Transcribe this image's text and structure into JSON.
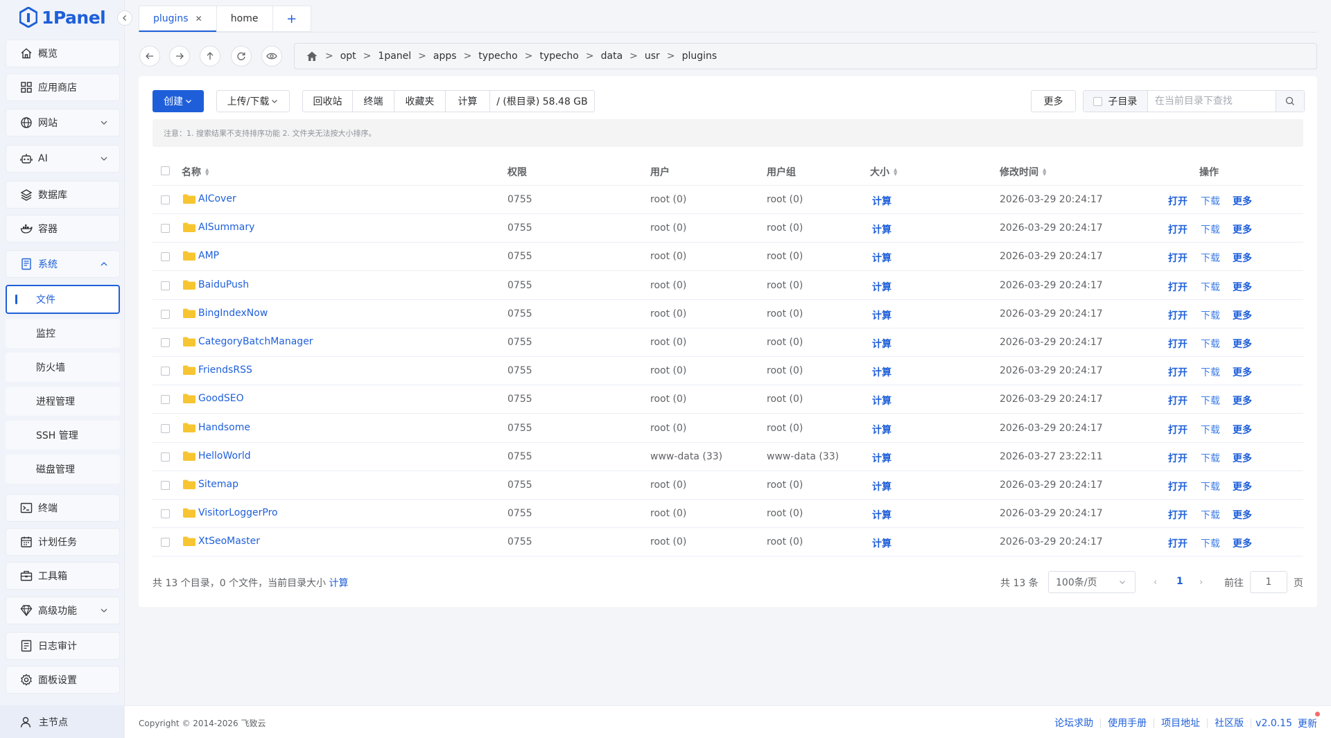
{
  "app": {
    "brand": "1Panel"
  },
  "sidebar": {
    "items": [
      {
        "label": "概览",
        "icon": "home-icon"
      },
      {
        "label": "应用商店",
        "icon": "grid-icon"
      },
      {
        "label": "网站",
        "icon": "globe-icon"
      },
      {
        "label": "AI",
        "icon": "robot-icon"
      },
      {
        "label": "数据库",
        "icon": "layers-icon"
      },
      {
        "label": "容器",
        "icon": "docker-icon"
      },
      {
        "label": "系统",
        "icon": "server-icon"
      }
    ],
    "sub_items": [
      "文件",
      "监控",
      "防火墙",
      "进程管理",
      "SSH 管理",
      "磁盘管理"
    ],
    "items_bottom": [
      {
        "label": "终端",
        "icon": "terminal-icon"
      },
      {
        "label": "计划任务",
        "icon": "calendar-icon"
      },
      {
        "label": "工具箱",
        "icon": "toolbox-icon"
      },
      {
        "label": "高级功能",
        "icon": "diamond-icon"
      },
      {
        "label": "日志审计",
        "icon": "log-icon"
      },
      {
        "label": "面板设置",
        "icon": "settings-icon"
      }
    ],
    "node": "主节点"
  },
  "tabs": [
    {
      "label": "plugins",
      "active": true
    },
    {
      "label": "home",
      "active": false
    }
  ],
  "path": [
    "opt",
    "1panel",
    "apps",
    "typecho",
    "typecho",
    "data",
    "usr",
    "plugins"
  ],
  "toolbar": {
    "create": "创建",
    "upload": "上传/下载",
    "recycle": "回收站",
    "terminal": "终端",
    "favorites": "收藏夹",
    "calc": "计算",
    "disk": "/ (根目录) 58.48 GB",
    "more": "更多",
    "subdir": "子目录",
    "search_placeholder": "在当前目录下查找"
  },
  "notice": "注意：1. 搜索结果不支持排序功能 2. 文件夹无法按大小排序。",
  "columns": {
    "name": "名称",
    "perm": "权限",
    "user": "用户",
    "group": "用户组",
    "size": "大小",
    "mtime": "修改时间",
    "ops": "操作"
  },
  "row_actions": {
    "size": "计算",
    "open": "打开",
    "download": "下载",
    "more": "更多"
  },
  "rows": [
    {
      "name": "AICover",
      "perm": "0755",
      "user": "root (0)",
      "group": "root (0)",
      "mtime": "2026-03-29 20:24:17"
    },
    {
      "name": "AISummary",
      "perm": "0755",
      "user": "root (0)",
      "group": "root (0)",
      "mtime": "2026-03-29 20:24:17"
    },
    {
      "name": "AMP",
      "perm": "0755",
      "user": "root (0)",
      "group": "root (0)",
      "mtime": "2026-03-29 20:24:17"
    },
    {
      "name": "BaiduPush",
      "perm": "0755",
      "user": "root (0)",
      "group": "root (0)",
      "mtime": "2026-03-29 20:24:17"
    },
    {
      "name": "BingIndexNow",
      "perm": "0755",
      "user": "root (0)",
      "group": "root (0)",
      "mtime": "2026-03-29 20:24:17"
    },
    {
      "name": "CategoryBatchManager",
      "perm": "0755",
      "user": "root (0)",
      "group": "root (0)",
      "mtime": "2026-03-29 20:24:17"
    },
    {
      "name": "FriendsRSS",
      "perm": "0755",
      "user": "root (0)",
      "group": "root (0)",
      "mtime": "2026-03-29 20:24:17"
    },
    {
      "name": "GoodSEO",
      "perm": "0755",
      "user": "root (0)",
      "group": "root (0)",
      "mtime": "2026-03-29 20:24:17"
    },
    {
      "name": "Handsome",
      "perm": "0755",
      "user": "root (0)",
      "group": "root (0)",
      "mtime": "2026-03-29 20:24:17"
    },
    {
      "name": "HelloWorld",
      "perm": "0755",
      "user": "www-data (33)",
      "group": "www-data (33)",
      "mtime": "2026-03-27 23:22:11"
    },
    {
      "name": "Sitemap",
      "perm": "0755",
      "user": "root (0)",
      "group": "root (0)",
      "mtime": "2026-03-29 20:24:17"
    },
    {
      "name": "VisitorLoggerPro",
      "perm": "0755",
      "user": "root (0)",
      "group": "root (0)",
      "mtime": "2026-03-29 20:24:17"
    },
    {
      "name": "XtSeoMaster",
      "perm": "0755",
      "user": "root (0)",
      "group": "root (0)",
      "mtime": "2026-03-29 20:24:17"
    }
  ],
  "summary": {
    "text": "共 13 个目录，0 个文件，当前目录大小",
    "calc": "计算"
  },
  "pagination": {
    "total": "共 13 条",
    "page_size": "100条/页",
    "current": "1",
    "goto": "前往",
    "page_input": "1",
    "page_unit": "页"
  },
  "footer": {
    "copyright": "Copyright © 2014-2026 飞致云",
    "links": [
      "论坛求助",
      "使用手册",
      "项目地址",
      "社区版"
    ],
    "version": "v2.0.15",
    "update": "更新"
  },
  "colors": {
    "accent": "#1e5fd9",
    "folder": "#f7c531"
  }
}
